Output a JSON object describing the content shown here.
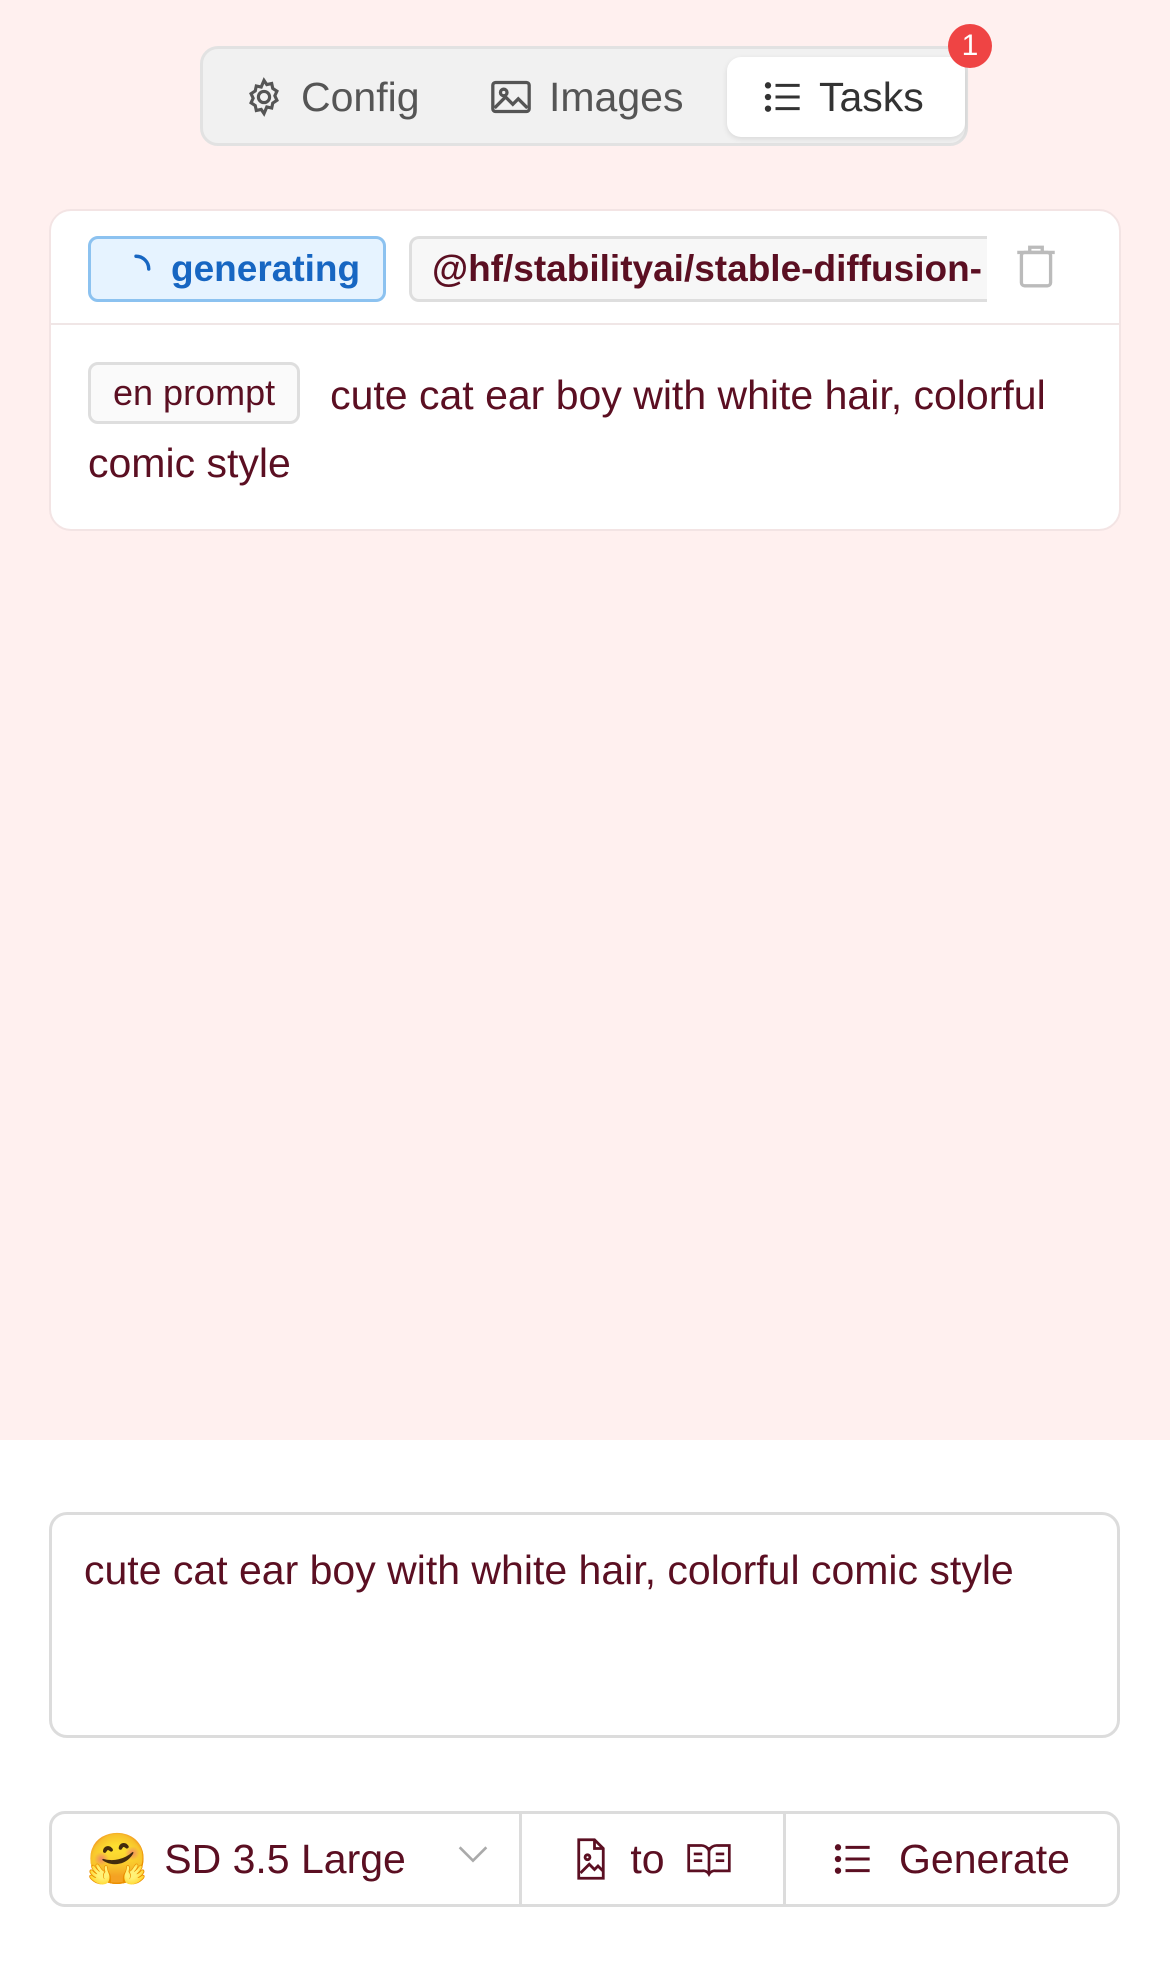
{
  "tabs": [
    {
      "label": "Config",
      "icon": "gear-icon"
    },
    {
      "label": "Images",
      "icon": "image-icon"
    },
    {
      "label": "Tasks",
      "icon": "list-icon",
      "active": true
    }
  ],
  "tasks_badge": "1",
  "task": {
    "status": "generating",
    "model": "@hf/stabilityai/stable-diffusion-",
    "prompt_tag": "en prompt",
    "prompt_text": "cute cat ear boy with white hair, colorful comic style"
  },
  "prompt_input": {
    "value": "cute cat ear boy with white hair, colorful comic style"
  },
  "toolbar": {
    "model_emoji": "🤗",
    "model_label": "SD 3.5 Large",
    "to_label": "to",
    "generate_label": "Generate"
  },
  "colors": {
    "background": "#fff0ef",
    "text": "#5b0f22",
    "status_blue": "#1766c2",
    "badge_red": "#ef4444"
  }
}
